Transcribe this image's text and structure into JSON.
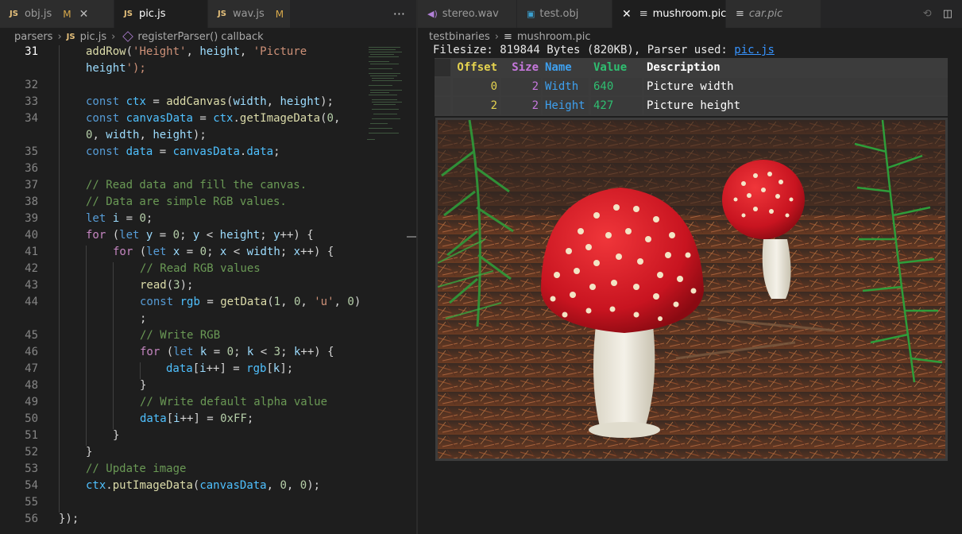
{
  "left_tabs": [
    {
      "label": "obj.js",
      "badge": "M",
      "active": false,
      "close": true
    },
    {
      "label": "pic.js",
      "badge": "",
      "active": true,
      "close": false
    },
    {
      "label": "wav.js",
      "badge": "M",
      "active": false,
      "close": false
    }
  ],
  "left_more": "···",
  "left_breadcrumb": {
    "folder": "parsers",
    "file": "pic.js",
    "symbol": "registerParser() callback"
  },
  "editor": {
    "current_line": 31,
    "line_numbers": [
      "31",
      "32",
      "33",
      "34",
      "35",
      "36",
      "37",
      "38",
      "39",
      "40",
      "41",
      "42",
      "43",
      "44",
      "45",
      "46",
      "47",
      "48",
      "49",
      "50",
      "51",
      "52",
      "53",
      "54",
      "55",
      "56"
    ],
    "code": [
      "addRow('Height', height, 'Picture",
      "height');",
      "const ctx = addCanvas(width, height);",
      "const canvasData = ctx.getImageData(0,",
      "0, width, height);",
      "const data = canvasData.data;",
      "// Read data and fill the canvas.",
      "// Data are simple RGB values.",
      "let i = 0;",
      "for (let y = 0; y < height; y++) {",
      "for (let x = 0; x < width; x++) {",
      "// Read RGB values",
      "read(3);",
      "const rgb = getData(1, 0, 'u', 0)",
      ";",
      "// Write RGB",
      "for (let k = 0; k < 3; k++) {",
      "data[i++] = rgb[k];",
      "}",
      "// Write default alpha value",
      "data[i++] = 0xFF;",
      "}",
      "}",
      "// Update image",
      "ctx.putImageData(canvasData, 0, 0);",
      "});"
    ]
  },
  "right_tabs": [
    {
      "label": "stereo.wav",
      "icon": "audio-file-icon",
      "active": false,
      "italic": false,
      "close": false
    },
    {
      "label": "test.obj",
      "icon": "object-file-icon",
      "active": false,
      "italic": false,
      "close": false
    },
    {
      "label": "mushroom.pic",
      "icon": "document-icon",
      "active": true,
      "italic": false,
      "close": true
    },
    {
      "label": "car.pic",
      "icon": "document-icon",
      "active": false,
      "italic": true,
      "close": false
    }
  ],
  "right_breadcrumb": {
    "folder": "testbinaries",
    "file": "mushroom.pic"
  },
  "fileinfo": {
    "prefix": "Filesize: 819844 Bytes (820KB), Parser used: ",
    "parser": "pic.js"
  },
  "table": {
    "headers": {
      "offset": "Offset",
      "size": "Size",
      "name": "Name",
      "value": "Value",
      "description": "Description"
    },
    "rows": [
      {
        "offset": "0",
        "size": "2",
        "name": "Width",
        "value": "640",
        "description": "Picture width"
      },
      {
        "offset": "2",
        "size": "2",
        "name": "Height",
        "value": "427",
        "description": "Picture height"
      }
    ]
  },
  "colors": {
    "offset": "#e5d34f",
    "size": "#c678dd",
    "name": "#3ea0ef",
    "value": "#2fbf71",
    "link": "#3794ff",
    "keyword": "#569cd6",
    "comment": "#6a9955"
  }
}
